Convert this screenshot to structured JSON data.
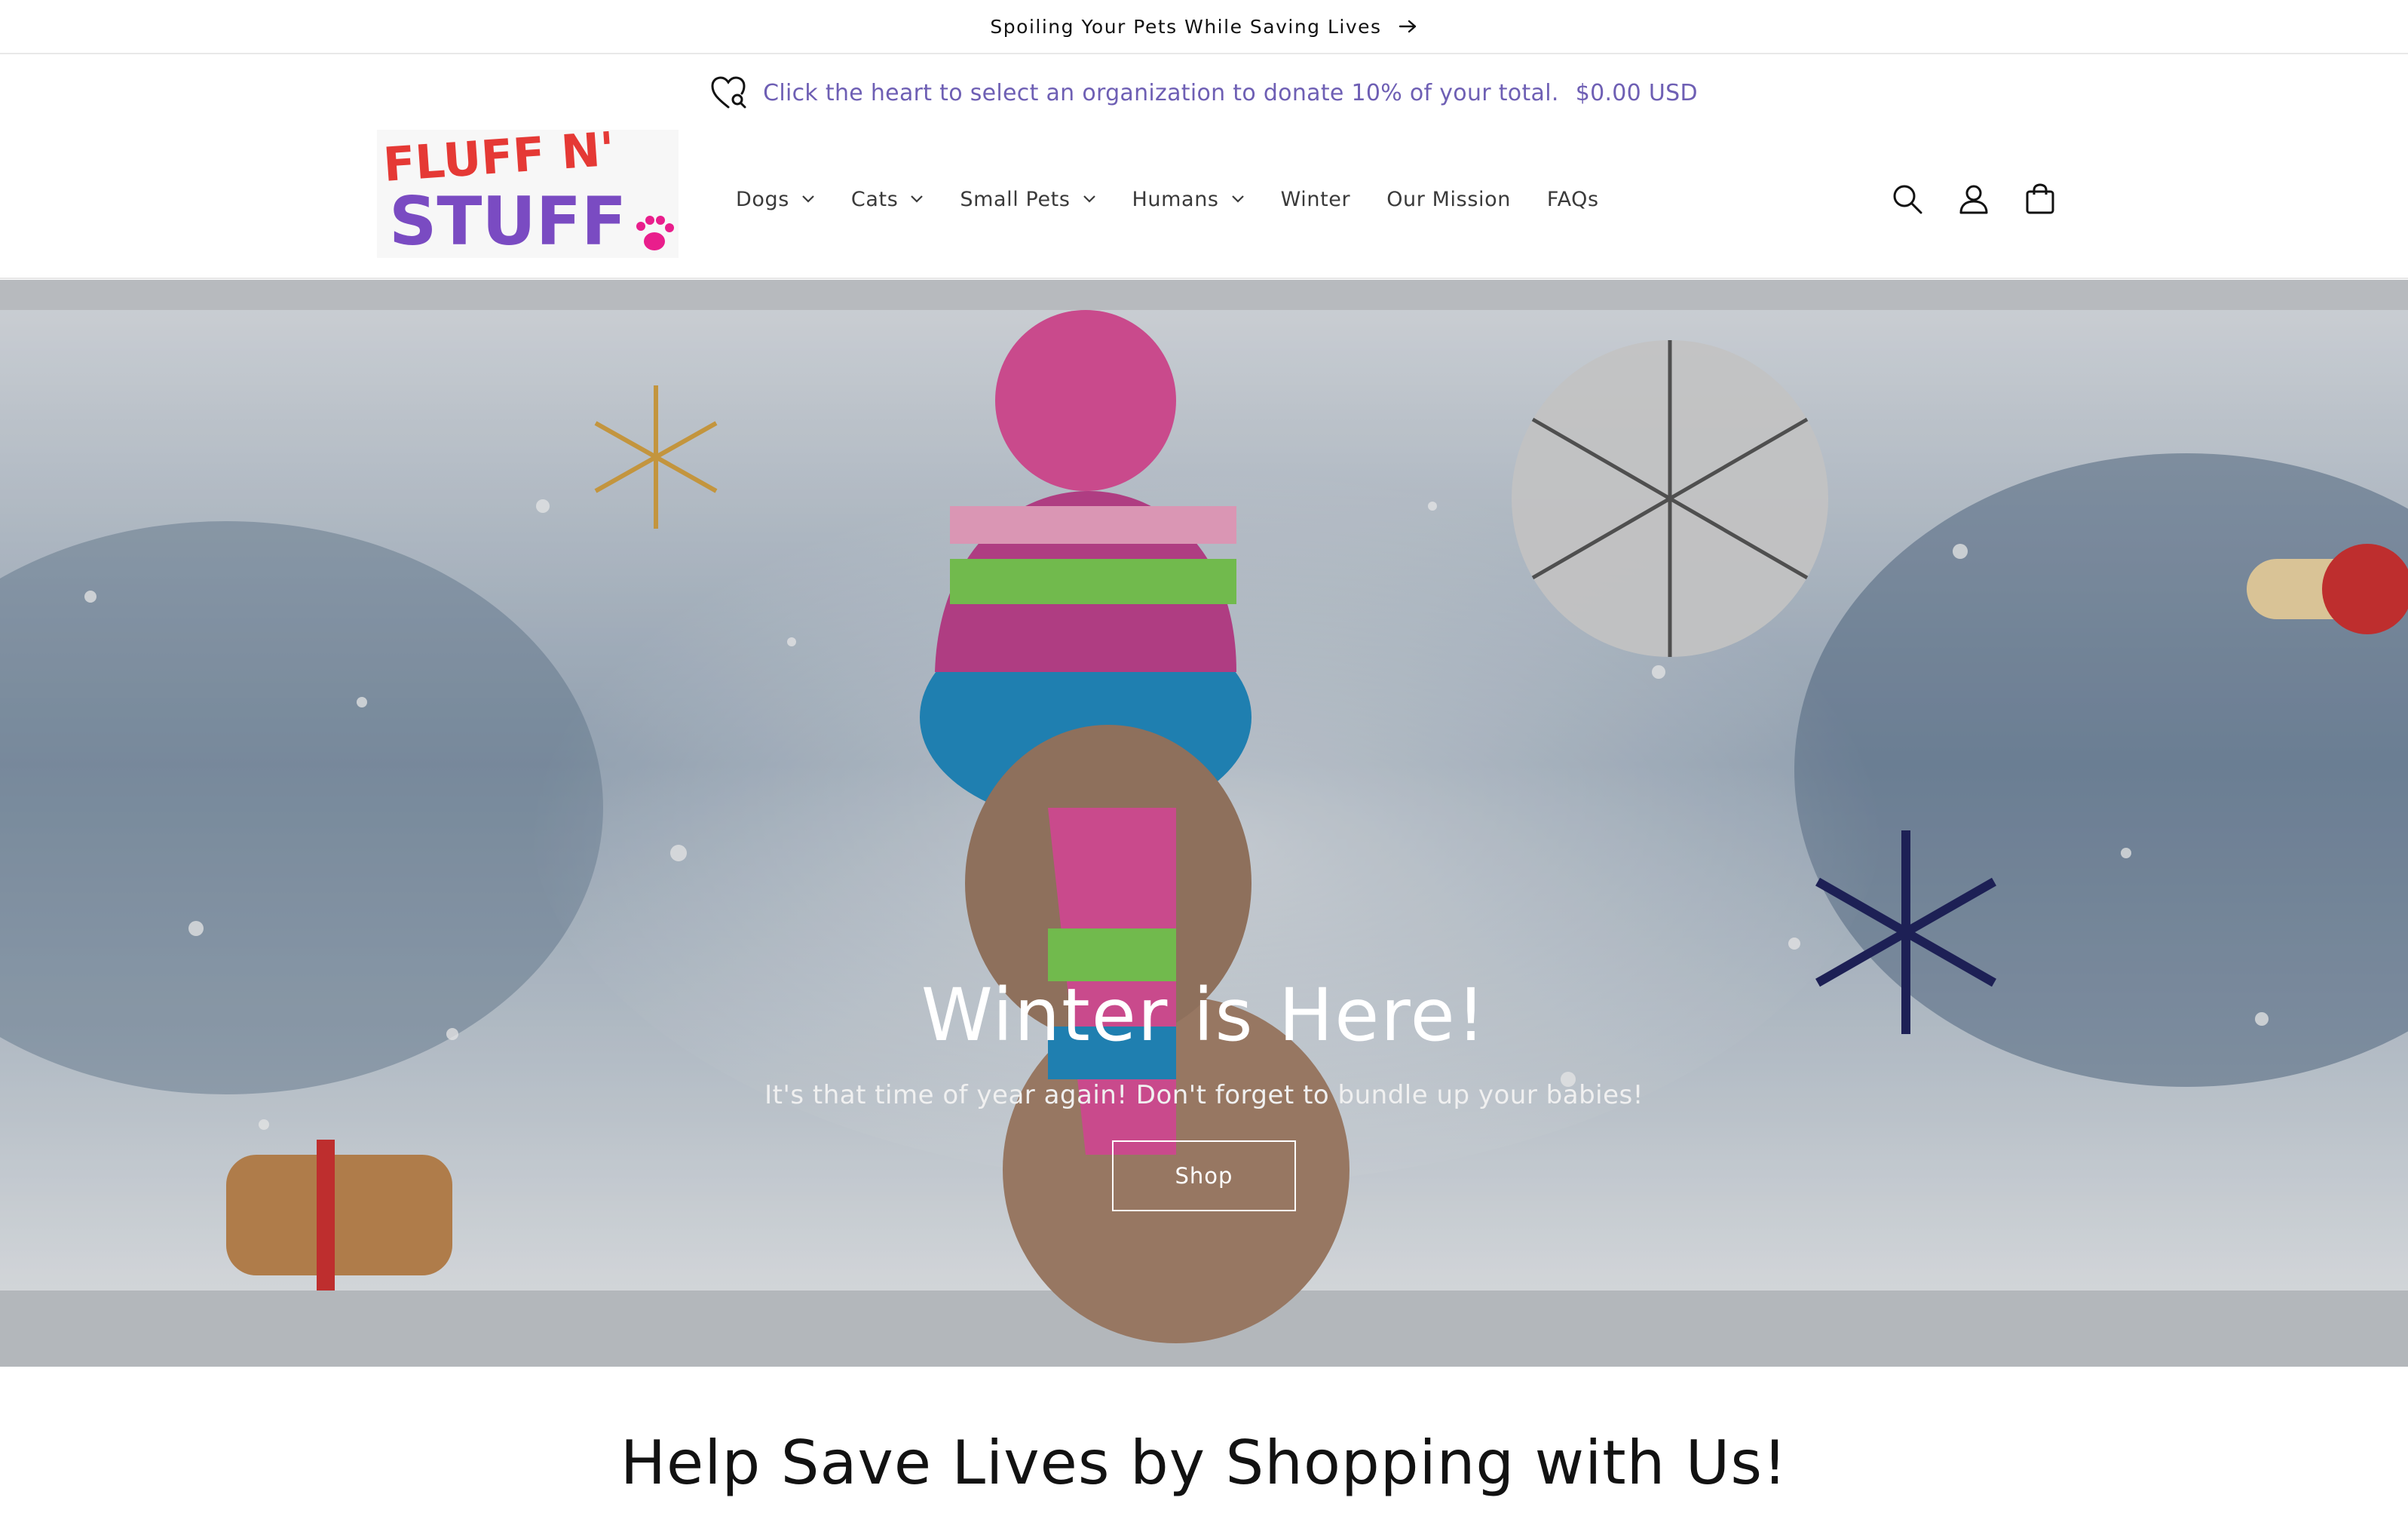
{
  "announcement": {
    "text": "Spoiling Your Pets While Saving Lives",
    "arrow_icon": "arrow-right-icon"
  },
  "donation": {
    "text": "Click the heart to select an organization to donate 10% of your total.",
    "amount": "$0.00 USD",
    "heart_icon": "heart-search-icon",
    "color": "#6e5fb4"
  },
  "logo": {
    "line1": "FLUFF N'",
    "line2": "STUFF"
  },
  "nav": {
    "items": [
      {
        "label": "Dogs",
        "dropdown": true
      },
      {
        "label": "Cats",
        "dropdown": true
      },
      {
        "label": "Small Pets",
        "dropdown": true
      },
      {
        "label": "Humans",
        "dropdown": true
      },
      {
        "label": "Winter",
        "dropdown": false
      },
      {
        "label": "Our Mission",
        "dropdown": false
      },
      {
        "label": "FAQs",
        "dropdown": false
      }
    ]
  },
  "header_icons": [
    "search-icon",
    "account-icon",
    "cart-icon"
  ],
  "hero": {
    "title": "Winter is Here!",
    "subtitle": "It's that time of year again! Don't forget to bundle up your babies!",
    "button_label": "Shop"
  },
  "section": {
    "title": "Help Save Lives by Shopping with Us!"
  }
}
